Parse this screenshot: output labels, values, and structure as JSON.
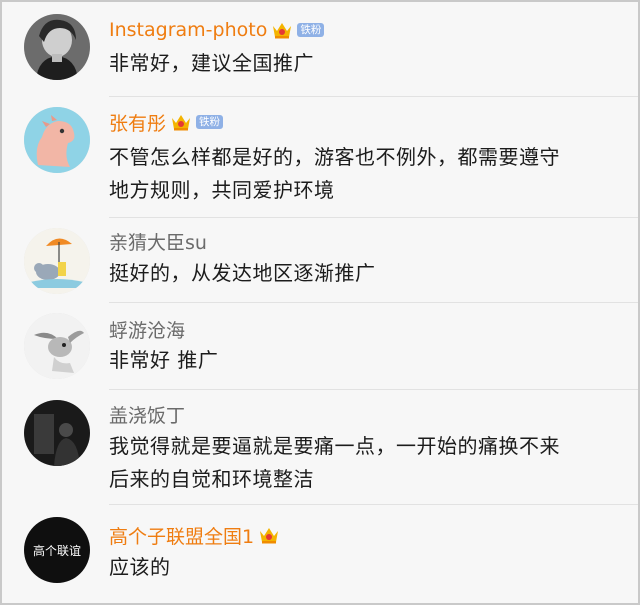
{
  "comments": [
    {
      "username": "Instagram-photo",
      "vip": true,
      "crown": true,
      "badge": "铁粉",
      "text": "非常好，建议全国推广",
      "avatar_icon": "woman-portrait-avatar"
    },
    {
      "username": "张有彤",
      "vip": true,
      "crown": true,
      "badge": "铁粉",
      "text_lines": [
        "不管怎么样都是好的，游客也不例外，都需要遵守",
        "地方规则，共同爱护环境"
      ],
      "avatar_icon": "pink-dinosaur-avatar"
    },
    {
      "username": "亲猜大臣su",
      "vip": false,
      "text": "挺好的，从发达地区逐渐推广",
      "avatar_icon": "elephant-umbrella-avatar"
    },
    {
      "username": "蜉游沧海",
      "vip": false,
      "text": "非常好 推广",
      "avatar_icon": "cartoon-rabbit-avatar"
    },
    {
      "username": "盖浇饭丁",
      "vip": false,
      "text_lines": [
        "我觉得就是要逼就是要痛一点，一开始的痛换不来",
        "后来的自觉和环境整洁"
      ],
      "avatar_icon": "dark-figure-avatar"
    },
    {
      "username": "高个子联盟全国1",
      "vip": true,
      "crown": true,
      "text": "应该的",
      "avatar_icon": "logo-avatar",
      "avatar_label": "高个联谊"
    }
  ],
  "colors": {
    "vip_name": "#ef7d11",
    "normal_name": "#6b6b6b",
    "badge_bg": "#8fb1e6",
    "background": "#f7f7f7"
  }
}
